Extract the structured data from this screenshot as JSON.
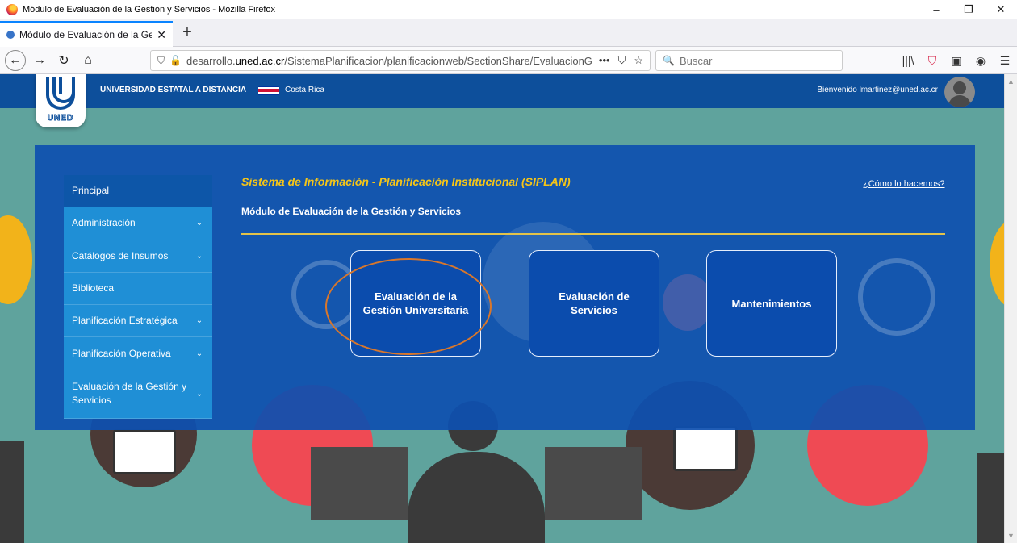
{
  "window": {
    "title": "Módulo de Evaluación de la Gestión y Servicios - Mozilla Firefox",
    "minimize": "–",
    "restore": "❐",
    "close": "✕"
  },
  "tab": {
    "title": "Módulo de Evaluación de la Ge",
    "close": "✕",
    "new_tab": "+"
  },
  "toolbar": {
    "back": "←",
    "forward": "→",
    "reload": "↻",
    "home": "⌂",
    "url_prefix": "desarrollo.",
    "url_domain": "uned.ac.cr",
    "url_path": "/SistemaPlanificacion/planificacionweb/SectionShare/EvaluacionGe",
    "page_actions": "•••",
    "pocket": "⛉",
    "bookmark": "☆",
    "search_placeholder": "Buscar",
    "library": "|||\\",
    "sidebar": "▣",
    "account": "◉",
    "menu": "☰"
  },
  "header": {
    "university": "UNIVERSIDAD ESTATAL A DISTANCIA",
    "country": "Costa Rica",
    "welcome": "Bienvenido lmartinez@uned.ac.cr",
    "logo_text": "UNED"
  },
  "sidebar": {
    "items": [
      {
        "label": "Principal",
        "chevron": ""
      },
      {
        "label": "Administración",
        "chevron": "⌄"
      },
      {
        "label": "Catálogos de Insumos",
        "chevron": "⌄"
      },
      {
        "label": "Biblioteca",
        "chevron": ""
      },
      {
        "label": "Planificación Estratégica",
        "chevron": "⌄"
      },
      {
        "label": "Planificación Operativa",
        "chevron": "⌄"
      },
      {
        "label": "Evaluación de la Gestión y Servicios",
        "chevron": "⌄"
      }
    ]
  },
  "main": {
    "title": "Sistema de Información - Planificación Institucional (SIPLAN)",
    "howto_link": "¿Cómo lo hacemos?",
    "subtitle": "Módulo de Evaluación de la Gestión y Servicios",
    "tiles": [
      {
        "label": "Evaluación de la Gestión Universitaria"
      },
      {
        "label": "Evaluación de Servicios"
      },
      {
        "label": "Mantenimientos"
      }
    ]
  },
  "colors": {
    "header_blue": "#0d4f9b",
    "panel_blue": "#0e50af",
    "sidebar_blue": "#1f8fd6",
    "title_yellow": "#f5c518",
    "highlight_orange": "#d9772b"
  }
}
